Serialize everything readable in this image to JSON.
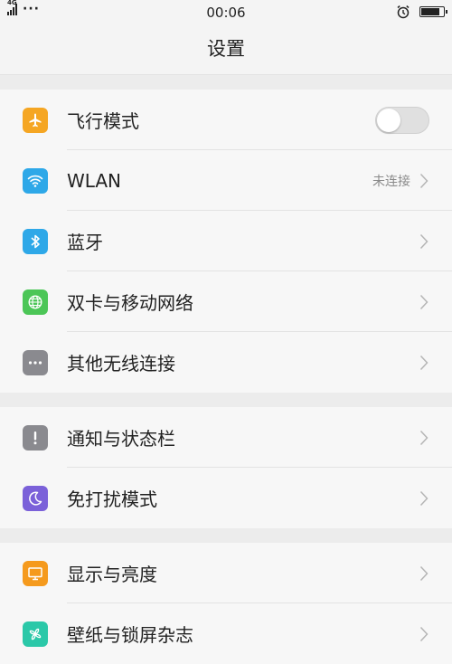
{
  "status_bar": {
    "network_tag": "4G",
    "time": "00:06",
    "battery_level": 0.85
  },
  "header": {
    "title": "设置"
  },
  "colors": {
    "airplane": "#f5a623",
    "wlan": "#2ea8e8",
    "bluetooth": "#2ea8e8",
    "network": "#4cc657",
    "other": "#8a8a8f",
    "notify": "#8a8a8f",
    "dnd": "#7b61d9",
    "display": "#f59a1d",
    "wallpaper": "#2bc8a8"
  },
  "groups": [
    {
      "items": [
        {
          "label": "飞行模式",
          "icon": "airplane-icon",
          "control": "toggle",
          "value": "off"
        },
        {
          "label": "WLAN",
          "icon": "wifi-icon",
          "state": "未连接",
          "control": "chevron"
        },
        {
          "label": "蓝牙",
          "icon": "bluetooth-icon",
          "control": "chevron"
        },
        {
          "label": "双卡与移动网络",
          "icon": "globe-icon",
          "control": "chevron"
        },
        {
          "label": "其他无线连接",
          "icon": "more-icon",
          "control": "chevron"
        }
      ]
    },
    {
      "items": [
        {
          "label": "通知与状态栏",
          "icon": "exclamation-icon",
          "control": "chevron"
        },
        {
          "label": "免打扰模式",
          "icon": "moon-icon",
          "control": "chevron"
        }
      ]
    },
    {
      "items": [
        {
          "label": "显示与亮度",
          "icon": "display-icon",
          "control": "chevron"
        },
        {
          "label": "壁纸与锁屏杂志",
          "icon": "flower-icon",
          "control": "chevron"
        }
      ]
    }
  ]
}
